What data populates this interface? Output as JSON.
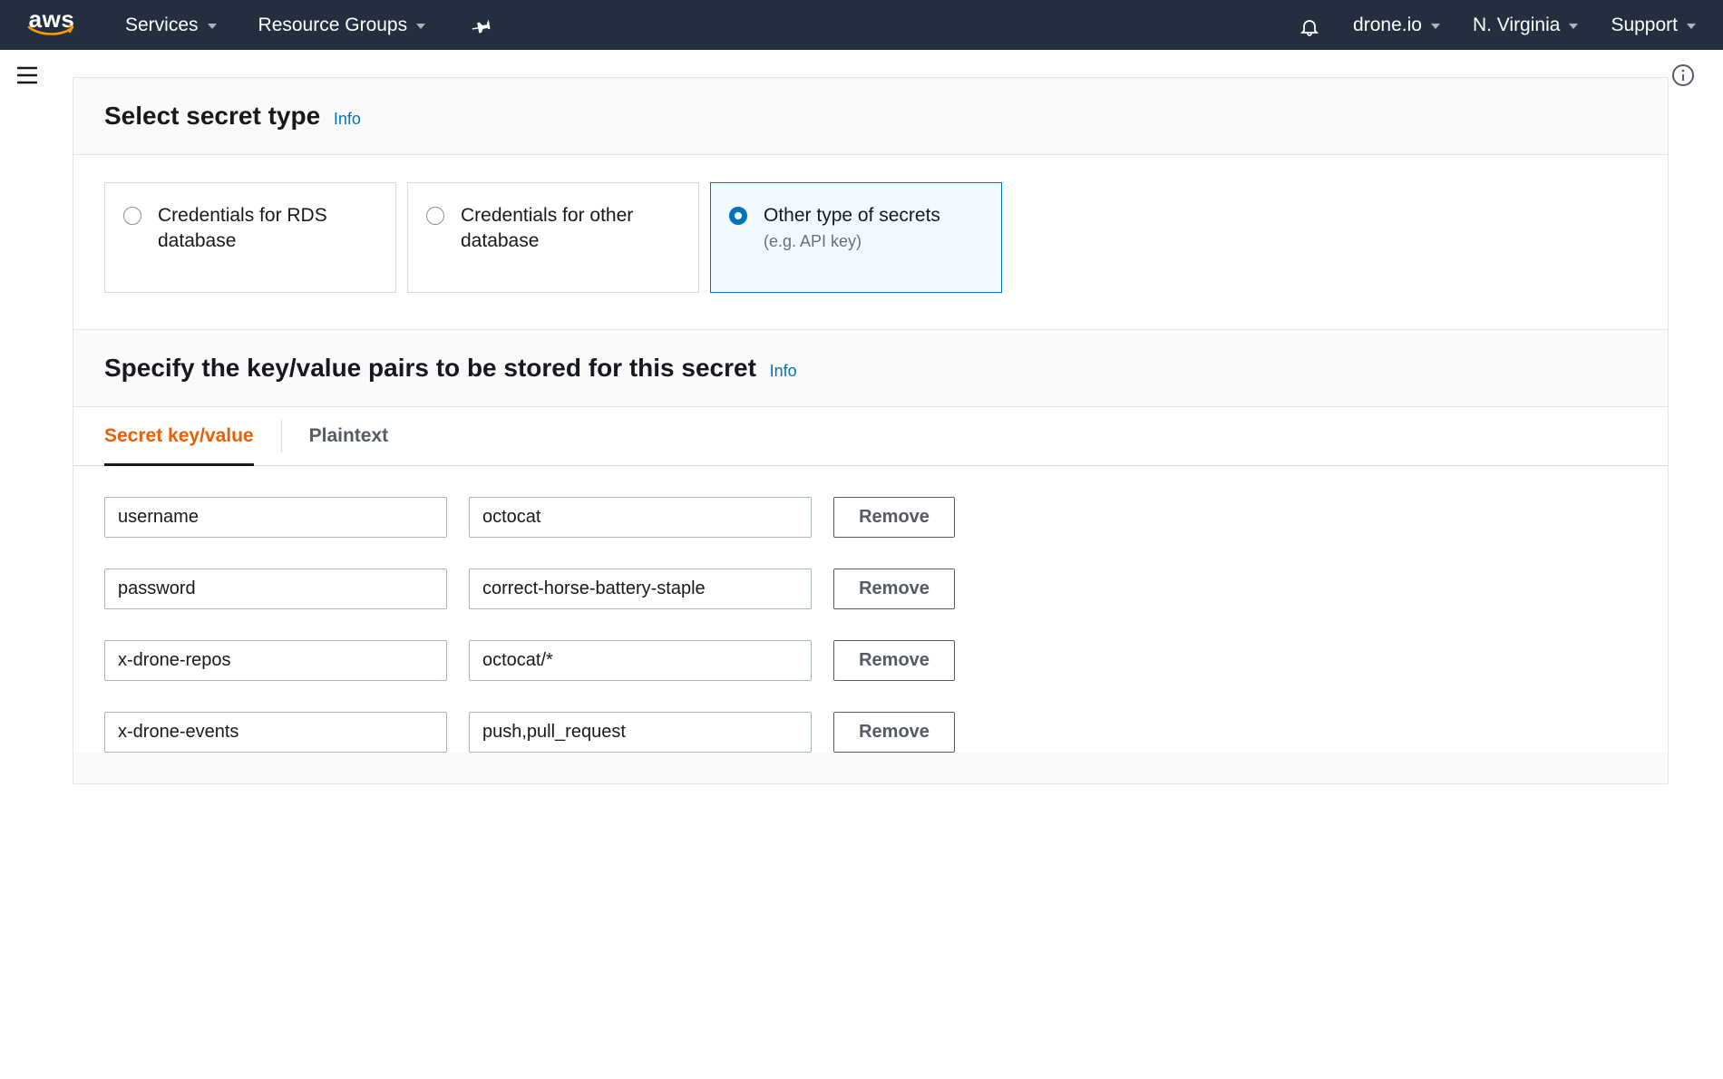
{
  "nav": {
    "logo_text": "aws",
    "services_label": "Services",
    "resource_groups_label": "Resource Groups",
    "account_label": "drone.io",
    "region_label": "N. Virginia",
    "support_label": "Support"
  },
  "section1": {
    "title": "Select secret type",
    "info_label": "Info",
    "options": [
      {
        "title": "Credentials for RDS database",
        "subtitle": "",
        "selected": false
      },
      {
        "title": "Credentials for other database",
        "subtitle": "",
        "selected": false
      },
      {
        "title": "Other type of secrets",
        "subtitle": "(e.g. API key)",
        "selected": true
      }
    ]
  },
  "section2": {
    "title": "Specify the key/value pairs to be stored for this secret",
    "info_label": "Info",
    "tabs": {
      "kv": "Secret key/value",
      "plaintext": "Plaintext"
    },
    "remove_label": "Remove",
    "pairs": [
      {
        "key": "username",
        "value": "octocat"
      },
      {
        "key": "password",
        "value": "correct-horse-battery-staple"
      },
      {
        "key": "x-drone-repos",
        "value": "octocat/*"
      },
      {
        "key": "x-drone-events",
        "value": "push,pull_request"
      }
    ]
  }
}
